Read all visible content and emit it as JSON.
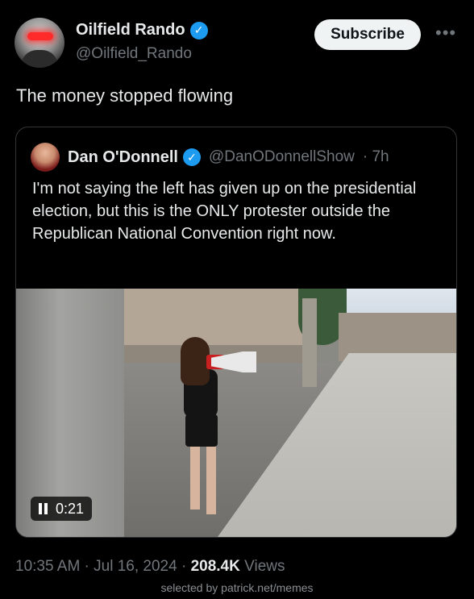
{
  "post": {
    "author_name": "Oilfield Rando",
    "author_handle": "@Oilfield_Rando",
    "subscribe_label": "Subscribe",
    "more_label": "•••",
    "text": "The money stopped flowing",
    "timestamp": "10:35 AM · Jul 16, 2024",
    "views_count": "208.4K",
    "views_label": "Views"
  },
  "quote": {
    "author_name": "Dan O'Donnell",
    "author_handle": "@DanODonnellShow",
    "age": "· 7h",
    "text": "I'm not saying the left has given up on the presidential election, but this is the ONLY protester outside the Republican National Convention right now.",
    "video_time": "0:21"
  },
  "credit": "selected by patrick.net/memes",
  "colors": {
    "background": "#000000",
    "text": "#e7e9ea",
    "secondary_text": "#71767b",
    "verified_blue": "#1d9bf0",
    "subscribe_bg": "#eff3f4"
  },
  "icons": [
    "verified-badge-icon",
    "more-icon",
    "pause-icon"
  ]
}
